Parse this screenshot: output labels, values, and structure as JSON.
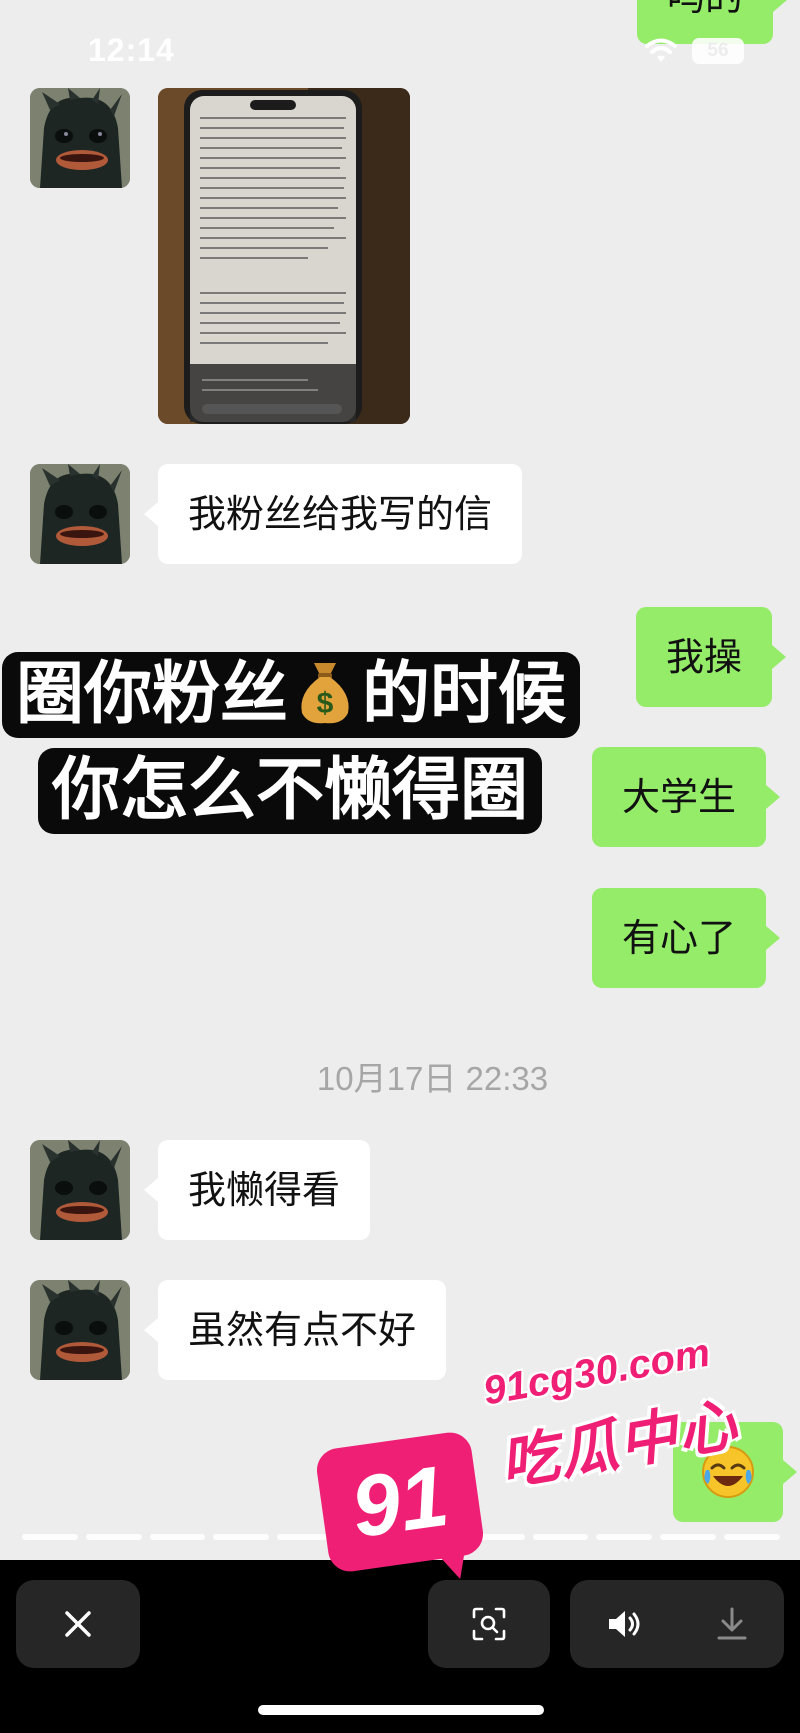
{
  "status_bar": {
    "time": "12:14",
    "battery": "56"
  },
  "top_partial_bubble": "吗的",
  "messages": [
    {
      "side": "incoming",
      "kind": "image",
      "description_icon": "handwritten-letter-photo"
    },
    {
      "side": "incoming",
      "text": "我粉丝给我写的信"
    },
    {
      "side": "outgoing",
      "text": "我操"
    },
    {
      "side": "outgoing",
      "text": "大学生"
    },
    {
      "side": "outgoing",
      "text": "有心了"
    },
    {
      "side": "incoming",
      "text": "我懒得看"
    },
    {
      "side": "incoming",
      "text": "虽然有点不好"
    },
    {
      "side": "outgoing",
      "kind": "emoji",
      "icon": "laughing-crying-emoji"
    }
  ],
  "timestamp": "10月17日 22:33",
  "caption": {
    "line1_before": "圈你粉丝",
    "line1_after": "的时候",
    "line2": "你怎么不懒得圈",
    "emoji": "money-bag-icon"
  },
  "watermark": {
    "badge": "91",
    "url": "91cg30.com",
    "name": "吃瓜中心"
  },
  "bottom_bar": {
    "close_icon": "close-icon",
    "scan_icon": "scan-icon",
    "sound_icon": "speaker-icon",
    "download_icon": "download-icon"
  },
  "colors": {
    "outgoing_bubble": "#95ec69",
    "incoming_bubble": "#ffffff",
    "background": "#ededed",
    "watermark": "#f01f76"
  }
}
